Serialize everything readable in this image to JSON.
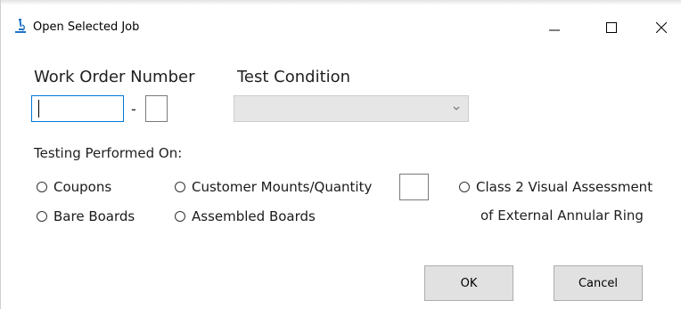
{
  "window": {
    "title": "Open Selected Job",
    "icon": "microscope-icon",
    "controls": {
      "minimize": "minimize-icon",
      "maximize": "maximize-icon",
      "close": "close-icon"
    }
  },
  "form": {
    "work_order_label": "Work Order Number",
    "work_order_value": "",
    "work_order_suffix_value": "",
    "separator": "-",
    "test_condition_label": "Test Condition",
    "test_condition_value": "",
    "testing_performed_label": "Testing Performed On:",
    "options": {
      "coupons": "Coupons",
      "customer_mounts": "Customer Mounts/Quantity",
      "class2_line1": "Class 2 Visual Assessment",
      "class2_line2": "of External Annular Ring",
      "bare_boards": "Bare Boards",
      "assembled_boards": "Assembled Boards"
    },
    "quantity_value": ""
  },
  "buttons": {
    "ok": "OK",
    "cancel": "Cancel"
  },
  "colors": {
    "focus_border": "#0078d7",
    "button_bg": "#e1e1e1",
    "combo_disabled_bg": "#e6e6e6",
    "icon_accent": "#1e73c8"
  }
}
